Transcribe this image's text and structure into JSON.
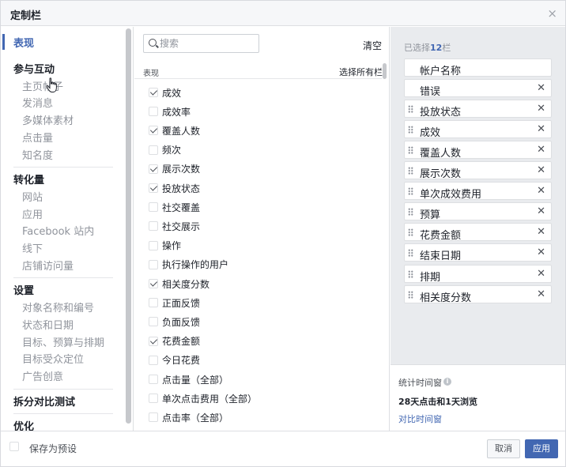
{
  "header": {
    "title": "定制栏",
    "close": "×"
  },
  "nav": {
    "active": "表现",
    "groups": [
      {
        "title": "参与互动",
        "items": [
          "主页帖子",
          "发消息",
          "多媒体素材",
          "点击量",
          "知名度"
        ]
      },
      {
        "title": "转化量",
        "items": [
          "网站",
          "应用",
          "Facebook 站内",
          "线下",
          "店铺访问量"
        ]
      },
      {
        "title": "设置",
        "items": [
          "对象名称和编号",
          "状态和日期",
          "目标、预算与排期",
          "目标受众定位",
          "广告创意"
        ]
      },
      {
        "title": "拆分对比测试",
        "items": []
      },
      {
        "title": "优化",
        "items": []
      }
    ]
  },
  "middle": {
    "search_placeholder": "搜索",
    "clear_label": "清空",
    "section_label": "表现",
    "select_all_label": "选择所有栏",
    "options": [
      {
        "label": "成效",
        "checked": true
      },
      {
        "label": "成效率",
        "checked": false
      },
      {
        "label": "覆盖人数",
        "checked": true
      },
      {
        "label": "频次",
        "checked": false
      },
      {
        "label": "展示次数",
        "checked": true
      },
      {
        "label": "投放状态",
        "checked": true
      },
      {
        "label": "社交覆盖",
        "checked": false
      },
      {
        "label": "社交展示",
        "checked": false
      },
      {
        "label": "操作",
        "checked": false
      },
      {
        "label": "执行操作的用户",
        "checked": false
      },
      {
        "label": "相关度分数",
        "checked": true
      },
      {
        "label": "正面反馈",
        "checked": false
      },
      {
        "label": "负面反馈",
        "checked": false
      },
      {
        "label": "花费金额",
        "checked": true
      },
      {
        "label": "今日花费",
        "checked": false
      },
      {
        "label": "点击量（全部）",
        "checked": false
      },
      {
        "label": "单次点击费用（全部）",
        "checked": false
      },
      {
        "label": "点击率（全部）",
        "checked": false
      }
    ]
  },
  "right": {
    "selected_prefix": "已选择",
    "selected_count": "12",
    "selected_suffix": "栏",
    "chips": [
      {
        "label": "帐户名称",
        "draggable": false,
        "removable": false
      },
      {
        "label": "错误",
        "draggable": false,
        "removable": true
      },
      {
        "label": "投放状态",
        "draggable": true,
        "removable": true
      },
      {
        "label": "成效",
        "draggable": true,
        "removable": true
      },
      {
        "label": "覆盖人数",
        "draggable": true,
        "removable": true
      },
      {
        "label": "展示次数",
        "draggable": true,
        "removable": true
      },
      {
        "label": "单次成效费用",
        "draggable": true,
        "removable": true
      },
      {
        "label": "预算",
        "draggable": true,
        "removable": true
      },
      {
        "label": "花费金额",
        "draggable": true,
        "removable": true
      },
      {
        "label": "结束日期",
        "draggable": true,
        "removable": true
      },
      {
        "label": "排期",
        "draggable": true,
        "removable": true
      },
      {
        "label": "相关度分数",
        "draggable": true,
        "removable": true
      }
    ],
    "remove_glyph": "✕",
    "stats_title": "统计时间窗",
    "stats_info": "i",
    "stats_value": "28天点击和1天浏览",
    "compare_link": "对比时间窗"
  },
  "footer": {
    "save_preset_label": "保存为预设",
    "cancel_label": "取消",
    "apply_label": "应用"
  },
  "colors": {
    "accent": "#4267b2",
    "panel_bg": "#e9ebee"
  }
}
